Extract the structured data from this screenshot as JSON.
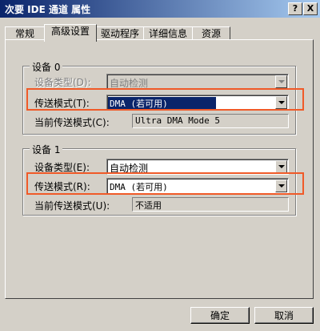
{
  "window": {
    "title": "次要 IDE 通道 属性",
    "help_label": "?",
    "close_label": "X"
  },
  "tabs": [
    {
      "label": "常规",
      "active": false
    },
    {
      "label": "高级设置",
      "active": true
    },
    {
      "label": "驱动程序",
      "active": false
    },
    {
      "label": "详细信息",
      "active": false
    },
    {
      "label": "资源",
      "active": false
    }
  ],
  "device0": {
    "title": "设备 0",
    "device_type_label": "设备类型(D):",
    "device_type_value": "自动检测",
    "transfer_mode_label": "传送模式(T):",
    "transfer_mode_value": "DMA (若可用)",
    "current_mode_label": "当前传送模式(C):",
    "current_mode_value": "Ultra DMA Mode 5"
  },
  "device1": {
    "title": "设备 1",
    "device_type_label": "设备类型(E):",
    "device_type_value": "自动检测",
    "transfer_mode_label": "传送模式(R):",
    "transfer_mode_value": "DMA (若可用)",
    "current_mode_label": "当前传送模式(U):",
    "current_mode_value": "不适用"
  },
  "buttons": {
    "ok_label": "确定",
    "cancel_label": "取消"
  },
  "colors": {
    "highlight": "#f05a28",
    "selection": "#0a246a"
  }
}
